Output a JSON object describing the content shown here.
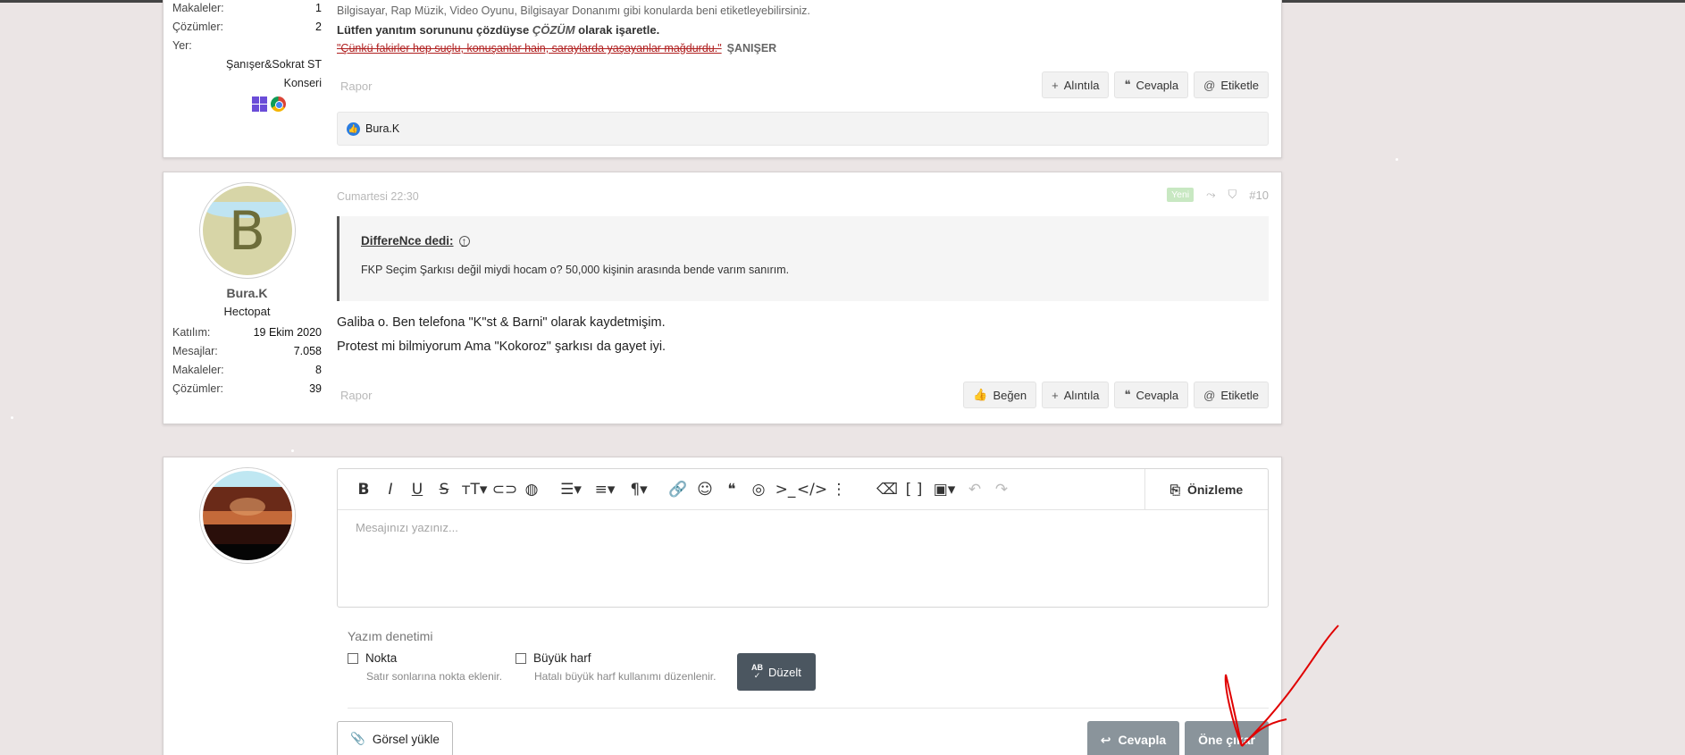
{
  "post1": {
    "stats": [
      {
        "label": "Makaleler:",
        "value": "1"
      },
      {
        "label": "Çözümler:",
        "value": "2"
      }
    ],
    "location_label": "Yer:",
    "location_value_line1": "Şanışer&Sokrat ST",
    "location_value_line2": "Konseri",
    "sig_line1": "Bilgisayar, Rap Müzik, Video Oyunu, Bilgisayar Donanımı gibi konularda beni etiketleyebilirsiniz.",
    "sig_line2_pre": "Lütfen yanıtım sorununu çözdüyse ",
    "sig_line2_em": "ÇÖZÜM",
    "sig_line2_post": " olarak işaretle.",
    "sig_quote": "\"Çünkü fakirler hep suçlu, konuşanlar hain, saraylarda yaşayanlar mağdurdu.\"",
    "sig_quote_author": "ŞANIŞER",
    "report": "Rapor",
    "actions": [
      "Alıntıla",
      "Cevapla",
      "Etiketle"
    ],
    "reaction_user": "Bura.K"
  },
  "post2": {
    "avatar_letter": "B",
    "username": "Bura.K",
    "user_title": "Hectopat",
    "stats": [
      {
        "label": "Katılım:",
        "value": "19 Ekim 2020"
      },
      {
        "label": "Mesajlar:",
        "value": "7.058"
      },
      {
        "label": "Makaleler:",
        "value": "8"
      },
      {
        "label": "Çözümler:",
        "value": "39"
      }
    ],
    "date": "Cumartesi 22:30",
    "new_badge": "Yeni",
    "post_number": "#10",
    "quote_author": "DiffereNce dedi:",
    "quote_text": "FKP Seçim Şarkısı değil miydi hocam o? 50,000 kişinin arasında bende varım sanırım.",
    "body_line1": "Galiba o. Ben telefona \"K\"st & Barni\" olarak kaydetmişim.",
    "body_line2": "Protest mi bilmiyorum Ama \"Kokoroz\" şarkısı da gayet iyi.",
    "report": "Rapor",
    "actions": [
      "Beğen",
      "Alıntıla",
      "Cevapla",
      "Etiketle"
    ]
  },
  "reply": {
    "preview_label": "Önizleme",
    "placeholder": "Mesajınızı yazınız...",
    "spell_title": "Yazım denetimi",
    "opt1_label": "Nokta",
    "opt1_hint": "Satır sonlarına nokta eklenir.",
    "opt2_label": "Büyük harf",
    "opt2_hint": "Hatalı büyük harf kullanımı düzenlenir.",
    "fix_label": "Düzelt",
    "upload_label": "Görsel yükle",
    "reply_label": "Cevapla",
    "feature_label": "Öne çıkar"
  },
  "colors": {
    "accent": "#4b5660",
    "submit": "#8a949b",
    "like": "#2a7ce0",
    "annotation": "#e00000"
  }
}
